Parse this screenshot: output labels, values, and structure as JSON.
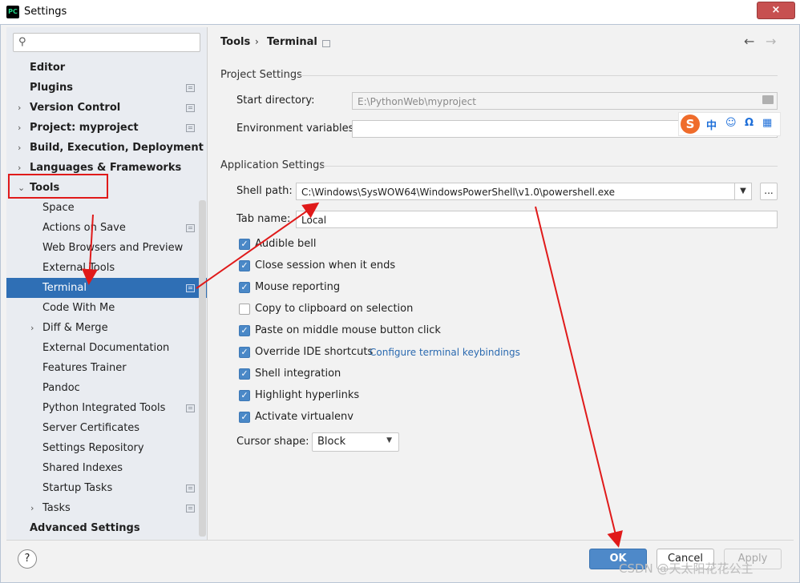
{
  "window": {
    "title": "Settings",
    "app_icon_text": "PC",
    "close_glyph": "×"
  },
  "search": {
    "placeholder": "",
    "icon": "search-icon"
  },
  "sidebar": {
    "items": [
      {
        "label": "Editor",
        "bold": true,
        "expand": false,
        "cfg": false,
        "indent": 0
      },
      {
        "label": "Plugins",
        "bold": true,
        "expand": false,
        "cfg": true,
        "indent": 0
      },
      {
        "label": "Version Control",
        "bold": true,
        "expand": "right",
        "cfg": true,
        "indent": 0
      },
      {
        "label": "Project: myproject",
        "bold": true,
        "expand": "right",
        "cfg": true,
        "indent": 0
      },
      {
        "label": "Build, Execution, Deployment",
        "bold": true,
        "expand": "right",
        "cfg": false,
        "indent": 0
      },
      {
        "label": "Languages & Frameworks",
        "bold": true,
        "expand": "right",
        "cfg": false,
        "indent": 0
      },
      {
        "label": "Tools",
        "bold": true,
        "expand": "down",
        "cfg": false,
        "indent": 0
      },
      {
        "label": "Space",
        "bold": false,
        "expand": false,
        "cfg": false,
        "indent": 1
      },
      {
        "label": "Actions on Save",
        "bold": false,
        "expand": false,
        "cfg": true,
        "indent": 1
      },
      {
        "label": "Web Browsers and Preview",
        "bold": false,
        "expand": false,
        "cfg": false,
        "indent": 1
      },
      {
        "label": "External Tools",
        "bold": false,
        "expand": false,
        "cfg": false,
        "indent": 1
      },
      {
        "label": "Terminal",
        "bold": false,
        "expand": false,
        "cfg": true,
        "indent": 1,
        "selected": true
      },
      {
        "label": "Code With Me",
        "bold": false,
        "expand": false,
        "cfg": false,
        "indent": 1
      },
      {
        "label": "Diff & Merge",
        "bold": false,
        "expand": "right",
        "cfg": false,
        "indent": 1
      },
      {
        "label": "External Documentation",
        "bold": false,
        "expand": false,
        "cfg": false,
        "indent": 1
      },
      {
        "label": "Features Trainer",
        "bold": false,
        "expand": false,
        "cfg": false,
        "indent": 1
      },
      {
        "label": "Pandoc",
        "bold": false,
        "expand": false,
        "cfg": false,
        "indent": 1
      },
      {
        "label": "Python Integrated Tools",
        "bold": false,
        "expand": false,
        "cfg": true,
        "indent": 1
      },
      {
        "label": "Server Certificates",
        "bold": false,
        "expand": false,
        "cfg": false,
        "indent": 1
      },
      {
        "label": "Settings Repository",
        "bold": false,
        "expand": false,
        "cfg": false,
        "indent": 1
      },
      {
        "label": "Shared Indexes",
        "bold": false,
        "expand": false,
        "cfg": false,
        "indent": 1
      },
      {
        "label": "Startup Tasks",
        "bold": false,
        "expand": false,
        "cfg": true,
        "indent": 1
      },
      {
        "label": "Tasks",
        "bold": false,
        "expand": "right",
        "cfg": true,
        "indent": 1
      },
      {
        "label": "Advanced Settings",
        "bold": true,
        "expand": false,
        "cfg": false,
        "indent": 0
      }
    ]
  },
  "breadcrumb": {
    "parent": "Tools",
    "separator": "›",
    "current": "Terminal"
  },
  "nav": {
    "back": "←",
    "forward": "→"
  },
  "project_settings": {
    "title": "Project Settings",
    "start_directory_label": "Start directory:",
    "start_directory_value": "E:\\PythonWeb\\myproject",
    "env_vars_label": "Environment variables:",
    "env_vars_value": ""
  },
  "app_settings": {
    "title": "Application Settings",
    "shell_path_label": "Shell path:",
    "shell_path_value": "C:\\Windows\\SysWOW64\\WindowsPowerShell\\v1.0\\powershell.exe",
    "browse_label": "...",
    "tab_name_label": "Tab name:",
    "tab_name_value": "Local",
    "checkboxes": [
      {
        "label": "Audible bell",
        "checked": true
      },
      {
        "label": "Close session when it ends",
        "checked": true
      },
      {
        "label": "Mouse reporting",
        "checked": true
      },
      {
        "label": "Copy to clipboard on selection",
        "checked": false
      },
      {
        "label": "Paste on middle mouse button click",
        "checked": true
      },
      {
        "label": "Override IDE shortcuts",
        "checked": true,
        "link": "Configure terminal keybindings"
      },
      {
        "label": "Shell integration",
        "checked": true
      },
      {
        "label": "Highlight hyperlinks",
        "checked": true
      },
      {
        "label": "Activate virtualenv",
        "checked": true
      }
    ],
    "cursor_shape_label": "Cursor shape:",
    "cursor_shape_value": "Block"
  },
  "footer": {
    "help": "?",
    "ok": "OK",
    "cancel": "Cancel",
    "apply": "Apply"
  },
  "ime": {
    "logo": "S",
    "glyphs": [
      "中",
      "☺",
      "Ω",
      "▦",
      "👕"
    ]
  },
  "watermark": "CSDN @天太阳花花公主",
  "colors": {
    "selection": "#2f6fb5",
    "accent": "#4e89c9",
    "annotation": "#e01a1a"
  }
}
